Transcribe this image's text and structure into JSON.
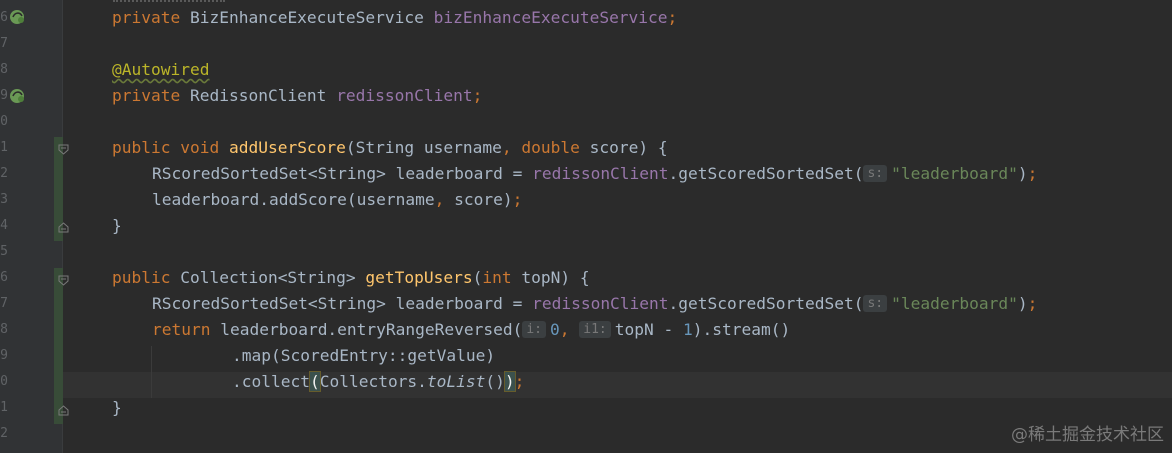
{
  "gutter": {
    "line_numbers": [
      "6",
      "7",
      "8",
      "9",
      "0",
      "1",
      "2",
      "3",
      "4",
      "5",
      "6",
      "7",
      "8",
      "9",
      "0",
      "1",
      "2"
    ],
    "icons": {
      "bean_icon": "spring-bean-injection-icon",
      "fold_icon": "fold-marker-icon"
    }
  },
  "code": {
    "line1": {
      "kw": "private",
      "type": "BizEnhanceExecuteService",
      "field": "bizEnhanceExecuteService",
      "end": ";"
    },
    "line3": {
      "annotation": "@Autowired"
    },
    "line4": {
      "kw": "private",
      "type": "RedissonClient",
      "field": "redissonClient",
      "end": ";"
    },
    "line6": {
      "kw1": "public",
      "kw2": "void",
      "method": "addUserScore",
      "p1": "(String username",
      "comma": ",",
      "kw3": "double",
      "p2": "score) {"
    },
    "line7": {
      "pre": "RScoredSortedSet<String> leaderboard = ",
      "field": "redissonClient",
      "call": ".getScoredSortedSet(",
      "hint": "s:",
      "str": "\"leaderboard\"",
      "close": ")",
      "end": ";"
    },
    "line8": {
      "text": "leaderboard.addScore(username",
      "comma": ",",
      "text2": " score)",
      "end": ";"
    },
    "line9": {
      "text": "}"
    },
    "line11": {
      "kw1": "public",
      "type": "Collection<String>",
      "method": "getTopUsers",
      "open": "(",
      "kw2": "int",
      "rest": "topN) {"
    },
    "line12": {
      "pre": "RScoredSortedSet<String> leaderboard = ",
      "field": "redissonClient",
      "call": ".getScoredSortedSet(",
      "hint": "s:",
      "str": "\"leaderboard\"",
      "close": ")",
      "end": ";"
    },
    "line13": {
      "kw": "return",
      "call": "leaderboard.entryRangeReversed(",
      "hint1": "i:",
      "num1": "0",
      "comma": ",",
      "hint2": "i1:",
      "rest": "topN - ",
      "num2": "1",
      "tail": ").stream()"
    },
    "line14": {
      "text": ".map(ScoredEntry::getValue)"
    },
    "line15": {
      "pre": ".collect",
      "open": "(",
      "mid": "Collectors.",
      "italic": "toList",
      "parens": "()",
      "close": ")",
      "end": ";"
    },
    "line16": {
      "text": "}"
    }
  },
  "watermark": "@稀土掘金技术社区",
  "colors": {
    "background": "#2b2b2b",
    "keyword": "#cc7832",
    "field": "#9876aa",
    "method": "#ffc66d",
    "string": "#6a8759",
    "number": "#6897bb",
    "annotation": "#bbb529",
    "default_text": "#a9b7c6"
  }
}
